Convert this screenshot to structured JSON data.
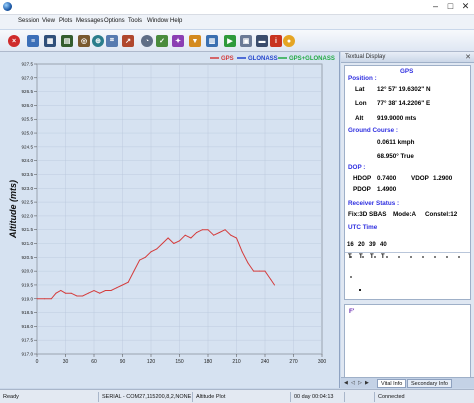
{
  "menu": [
    "Session",
    "View",
    "Plots",
    "Messages",
    "Options",
    "Tools",
    "Window",
    "Help"
  ],
  "toolbar_icons": [
    "close-session-icon",
    "report-icon",
    "table-icon",
    "grid-icon",
    "target-icon",
    "globe-icon",
    "chart-icon",
    "gauge-icon",
    "compass-icon",
    "constellation-icon",
    "antenna-icon",
    "filter-icon",
    "run-icon",
    "panel-icon",
    "save-icon",
    "info-icon"
  ],
  "plot": {
    "ylabel": "Altitude (mts)",
    "legend": [
      {
        "name": "GPS",
        "color": "#d43c3c"
      },
      {
        "name": "GLONASS",
        "color": "#2244cc"
      },
      {
        "name": "GPS+GLONASS",
        "color": "#22aa44"
      }
    ]
  },
  "chart_data": {
    "type": "line",
    "title": "",
    "xlabel": "",
    "ylabel": "Altitude (mts)",
    "xlim": [
      0,
      300
    ],
    "ylim": [
      917.0,
      927.5
    ],
    "x_ticks": [
      0,
      30,
      60,
      90,
      120,
      150,
      180,
      210,
      240,
      270,
      300
    ],
    "y_ticks": [
      "917.0",
      "917.5",
      "918.0",
      "918.5",
      "919.0",
      "919.5",
      "920.0",
      "920.5",
      "921.0",
      "921.5",
      "922.0",
      "922.5",
      "923.0",
      "923.5",
      "924.0",
      "924.5",
      "925.0",
      "925.5",
      "926.0",
      "926.5",
      "927.0",
      "927.5"
    ],
    "grid": true,
    "legend_position": "top-right",
    "series": [
      {
        "name": "GPS",
        "color": "#d43c3c",
        "x": [
          0,
          8,
          15,
          20,
          25,
          30,
          36,
          42,
          48,
          54,
          60,
          66,
          72,
          78,
          84,
          90,
          96,
          102,
          108,
          114,
          120,
          126,
          132,
          138,
          144,
          150,
          156,
          162,
          168,
          174,
          180,
          186,
          192,
          198,
          204,
          210,
          216,
          222,
          228,
          234,
          240,
          246,
          250
        ],
        "y": [
          919.0,
          919.0,
          919.0,
          919.2,
          919.3,
          919.2,
          919.2,
          919.1,
          919.1,
          919.2,
          919.3,
          919.2,
          919.3,
          919.3,
          919.4,
          919.5,
          919.6,
          920.0,
          920.4,
          920.5,
          920.7,
          920.8,
          921.0,
          921.2,
          921.0,
          921.1,
          921.3,
          921.2,
          921.4,
          921.5,
          921.5,
          921.3,
          921.4,
          921.5,
          921.3,
          921.2,
          920.7,
          920.3,
          920.0,
          920.0,
          920.0,
          919.7,
          919.5
        ]
      }
    ]
  },
  "textual": {
    "title": "Textual Display",
    "system": "GPS",
    "position_header": "Position :",
    "lat_label": "Lat",
    "lat_value": "12° 57' 19.6302\" N",
    "lon_label": "Lon",
    "lon_value": "77° 38' 14.2206\" E",
    "alt_label": "Alt",
    "alt_value": "919.9000 mts",
    "ground_header": "Ground Course :",
    "speed": "0.0611 kmph",
    "course": "68.950° True",
    "dop_header": "DOP :",
    "hdop_label": "HDOP",
    "hdop_value": "0.7400",
    "vdop_label": "VDOP",
    "vdop_value": "1.2900",
    "pdop_label": "PDOP",
    "pdop_value": "1.4900",
    "receiver_header": "Receiver Status :",
    "fix": "Fix:3D SBAS",
    "mode": "Mode:A",
    "constel": "Constel:12",
    "utc_header": "UTC Time",
    "sat_ids": [
      "16",
      "20",
      "39",
      "40"
    ],
    "sat_status": [
      "T",
      "T",
      "T",
      "T"
    ],
    "sky_label": "F'"
  },
  "tabs": [
    "Vital Info",
    "Secondary Info"
  ],
  "status": {
    "ready": "Ready",
    "port": "SERIAL - COM27,115200,8,2,NONE",
    "view": "Altitude Plot",
    "time": "00 day 00:04:13",
    "connection": "Connected"
  }
}
